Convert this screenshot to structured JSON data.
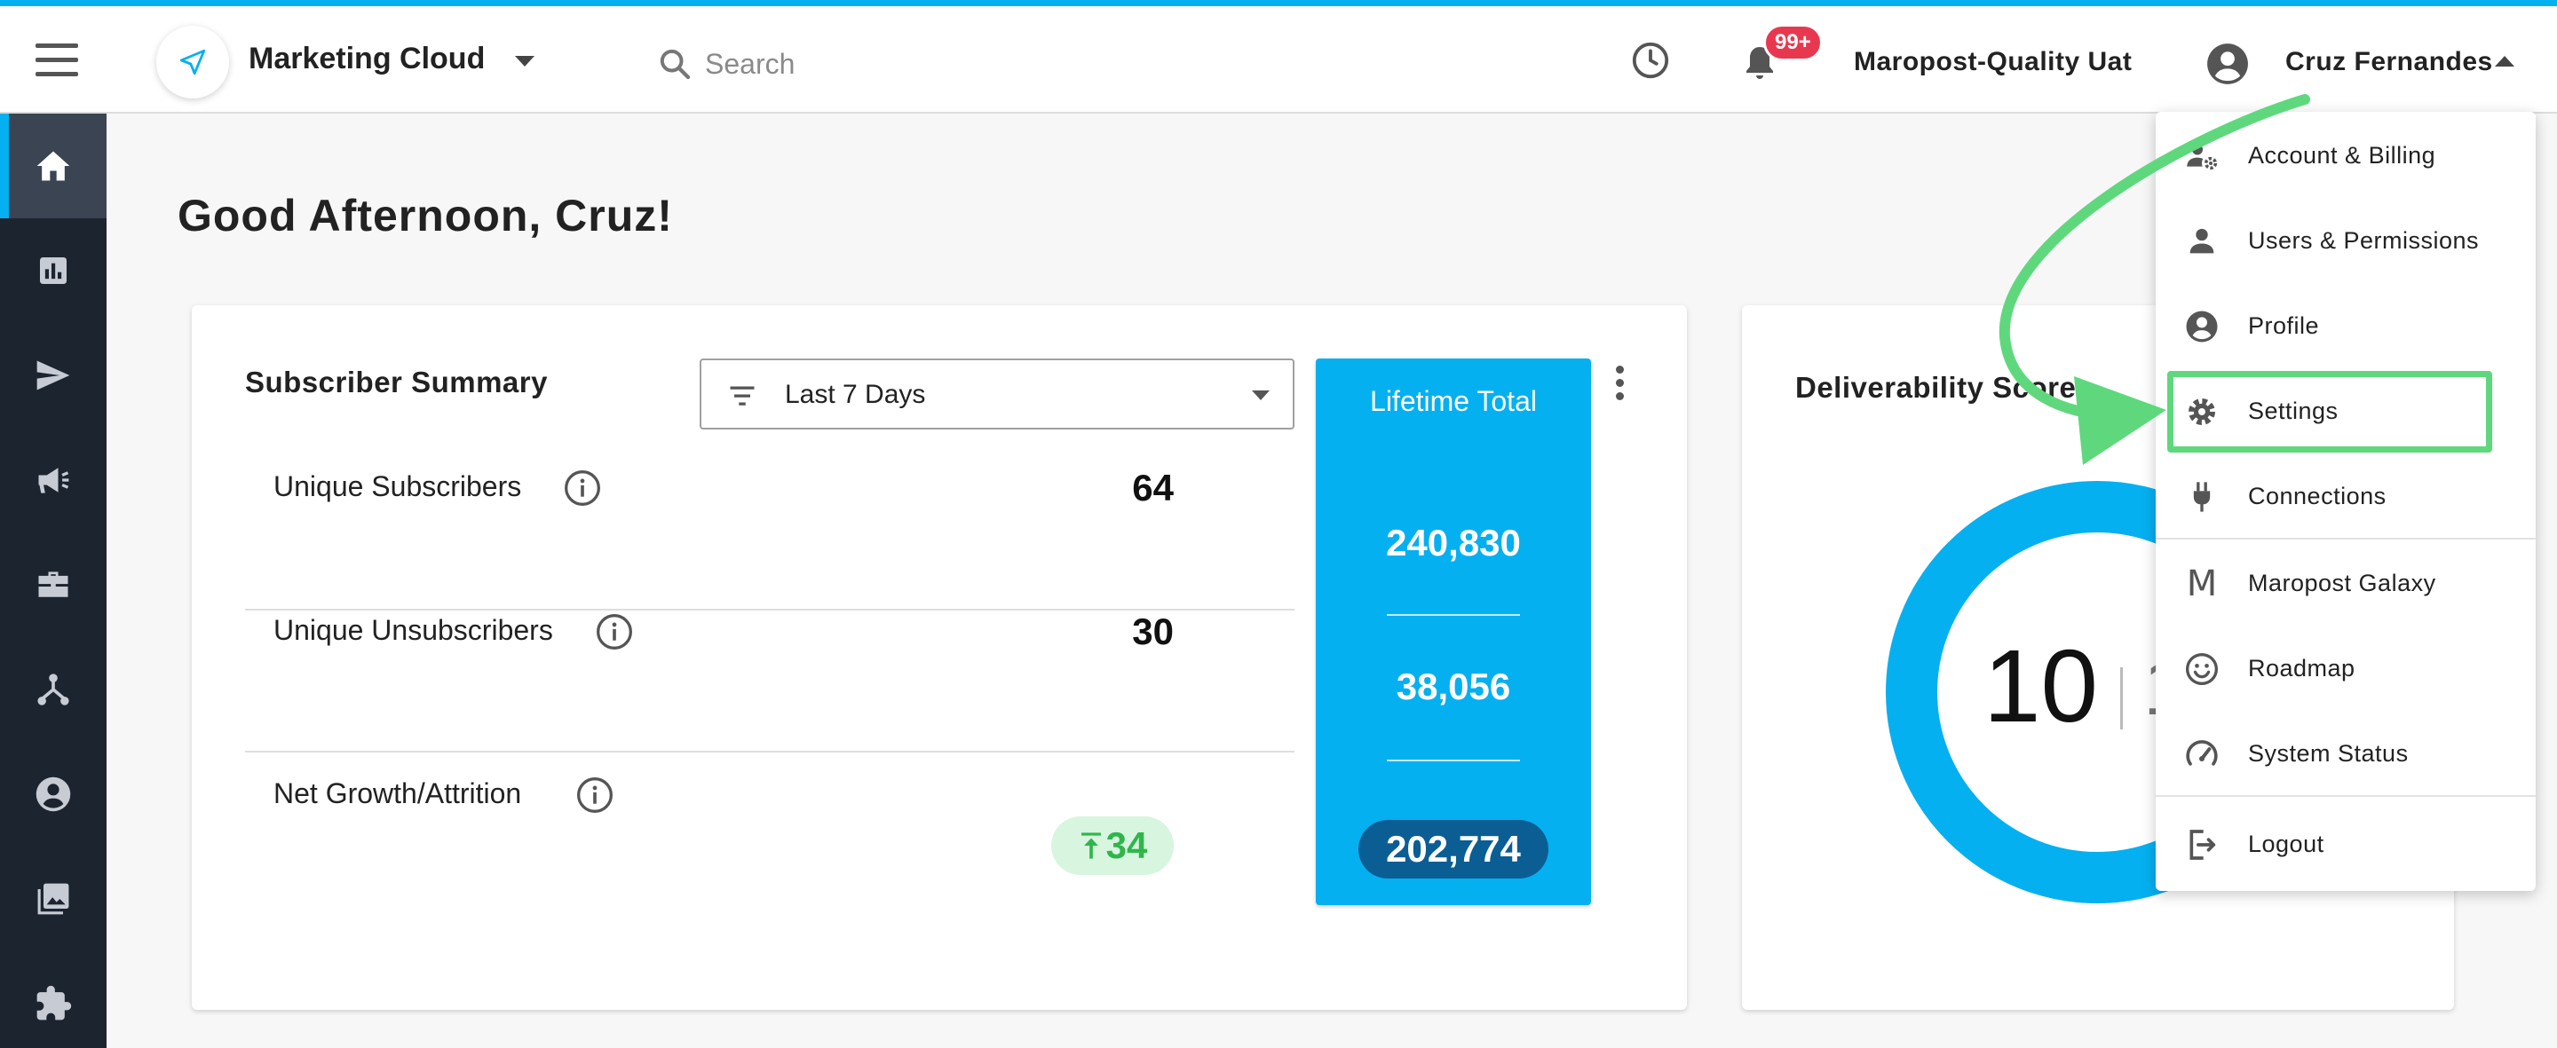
{
  "header": {
    "product_name": "Marketing Cloud",
    "search_placeholder": "Search",
    "notification_badge": "99+",
    "account_name": "Maropost-Quality Uat",
    "user_name": "Cruz Fernandes"
  },
  "sidebar": {
    "items": [
      {
        "icon": "home-icon",
        "active": true
      },
      {
        "icon": "reports-icon",
        "active": false
      },
      {
        "icon": "send-icon",
        "active": false
      },
      {
        "icon": "megaphone-icon",
        "active": false
      },
      {
        "icon": "briefcase-icon",
        "active": false
      },
      {
        "icon": "journey-icon",
        "active": false
      },
      {
        "icon": "contact-icon",
        "active": false
      },
      {
        "icon": "gallery-icon",
        "active": false
      },
      {
        "icon": "puzzle-icon",
        "active": false
      }
    ]
  },
  "greeting": "Good Afternoon, Cruz!",
  "subscriber_summary": {
    "title": "Subscriber Summary",
    "range": "Last 7 Days",
    "rows": [
      {
        "label": "Unique Subscribers",
        "value": "64"
      },
      {
        "label": "Unique Unsubscribers",
        "value": "30"
      },
      {
        "label": "Net Growth/Attrition",
        "value": "34",
        "trend": "up"
      }
    ],
    "lifetime": {
      "title": "Lifetime Total",
      "subscribers": "240,830",
      "unsubscribers": "38,056",
      "net": "202,774"
    }
  },
  "deliverability": {
    "title": "Deliverability Score",
    "score": "10",
    "score_tail": "1"
  },
  "user_menu": {
    "items": [
      {
        "label": "Account & Billing",
        "icon": "account-settings-icon"
      },
      {
        "label": "Users & Permissions",
        "icon": "person-icon"
      },
      {
        "label": "Profile",
        "icon": "profile-icon"
      },
      {
        "label": "Settings",
        "icon": "gear-icon",
        "highlighted": true
      },
      {
        "label": "Connections",
        "icon": "plug-icon"
      },
      {
        "label": "Maropost Galaxy",
        "icon": "maropost-m-icon"
      },
      {
        "label": "Roadmap",
        "icon": "smiley-icon"
      },
      {
        "label": "System Status",
        "icon": "speedometer-icon"
      },
      {
        "label": "Logout",
        "icon": "logout-icon"
      }
    ]
  },
  "colors": {
    "accent": "#05b0f0",
    "sidebar": "#1c2430",
    "badge": "#e8384f",
    "growth": "#2fb64b",
    "highlight": "#5fd87d",
    "lifetime_pill": "#0b5e94"
  }
}
